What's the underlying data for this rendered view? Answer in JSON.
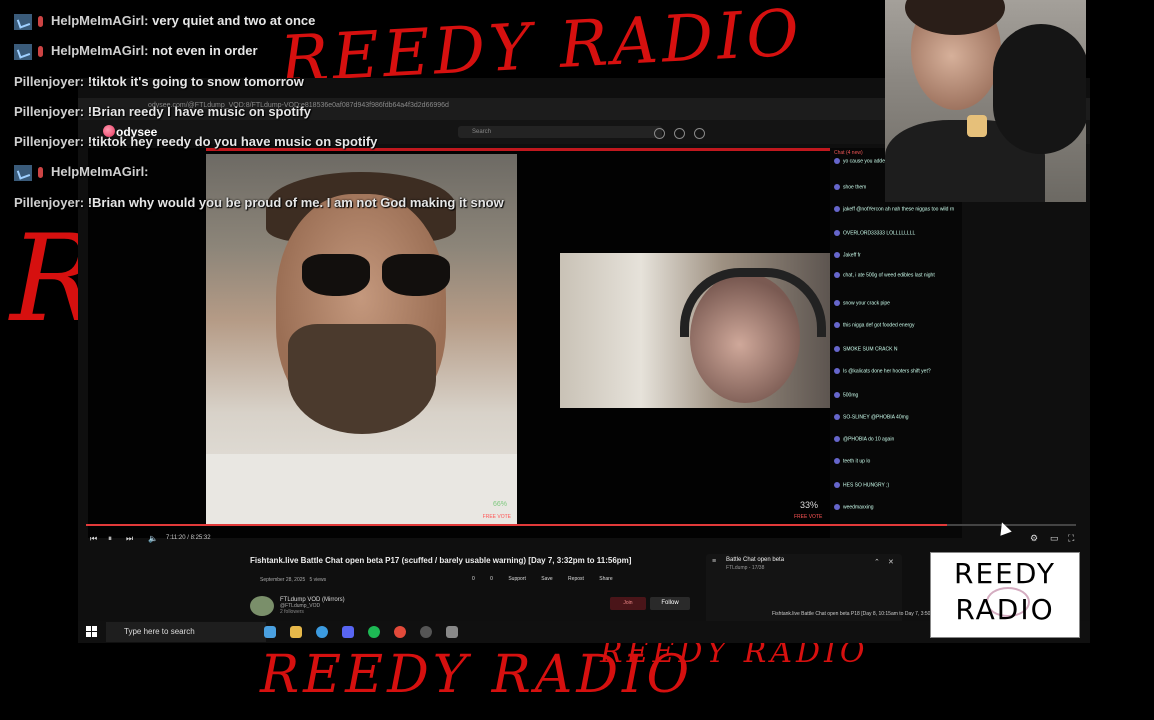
{
  "background": {
    "scribbles": [
      "REEDY RADIO",
      "R",
      "REEDY RADIO",
      "REEDY RADIO"
    ]
  },
  "chat_overlay": [
    {
      "user": "HelpMeImAGirl:",
      "message": "very quiet and two at once",
      "badge": true
    },
    {
      "user": "HelpMeImAGirl:",
      "message": "not even in order",
      "badge": true
    },
    {
      "user": "Pillenjoyer:",
      "message": "!tiktok it's going to snow tomorrow",
      "badge": false
    },
    {
      "user": "Pillenjoyer:",
      "message": "!Brian reedy I have music on spotify",
      "badge": false
    },
    {
      "user": "Pillenjoyer:",
      "message": "!tiktok hey reedy do you have music on spotify",
      "badge": false
    },
    {
      "user": "HelpMeImAGirl:",
      "message": "",
      "badge": true
    },
    {
      "user": "Pillenjoyer:",
      "message": "!Brian why would you be proud of me. I am not God making it snow",
      "badge": false
    }
  ],
  "browser": {
    "url": "odysee.com/@FTLdump_VOD:8/FTLdump-VOD:e818536e0af087d943f986fdb64a4f3d2d66996d",
    "site_name": "odysee",
    "search_placeholder": "Search"
  },
  "player": {
    "time": "7:11:20 / 8:25:32",
    "vote_left": "66%",
    "vote_right": "33%",
    "vote_label": "FREE VOTE",
    "progress": 0.87
  },
  "stream_chat": {
    "header": "Chat (4 new)",
    "rows": [
      "yo cause you added",
      "shoe them",
      "jakeff @notYercon ah nah these niggas too wild rn",
      "OVERLORD33333 LOLLLLLLLL",
      "Jakeff fr",
      "chat, i ate 500g of weed edibles last night",
      "snow your crack pipe",
      "this nigga def got fooded energy",
      "SMOKE SUM CRACK N",
      "Is @kalicats done her hooters shift yet?",
      "500mg",
      "SO-SLINEY @PHOBIA 40mg",
      "@PHOBIA do 10 again",
      "teeth it up lo",
      "HES SO HUNGRY ;)",
      "weedmaxxing"
    ]
  },
  "video_info": {
    "title": "Fishtank.live Battle Chat open beta P17 (scuffed / barely usable warning) [Day 7, 3:32pm to 11:56pm]",
    "date": "September 28, 2025",
    "views": "5 views",
    "actions": [
      "0",
      "0",
      "Support",
      "Save",
      "Repost",
      "Share"
    ],
    "channel_name": "FTLdump VOD (Mirrors)",
    "channel_handle": "@FTLdump_VOD",
    "followers": "2 followers",
    "join_label": "Join",
    "follow_label": "Follow"
  },
  "playlist": {
    "title": "Battle Chat open beta",
    "subtitle": "FTLdump - 17/38",
    "item": "Fishtank.live Battle Chat open beta P18 [Day 8, 10:15am to Day 7, 3:50am]"
  },
  "taskbar": {
    "search_placeholder": "Type here to search",
    "icons": [
      "windows-icon",
      "chrome-icon",
      "file-explorer-icon",
      "telegram-icon",
      "discord-icon",
      "spotify-icon",
      "chrome-icon",
      "settings-icon",
      "app-icon"
    ]
  },
  "logo_box": {
    "line1": "REEDY",
    "line2": "RADIO"
  },
  "colors": {
    "scribble_red": "#d6100f",
    "accent_red": "#c0181e",
    "progress": "#e23a3a"
  }
}
